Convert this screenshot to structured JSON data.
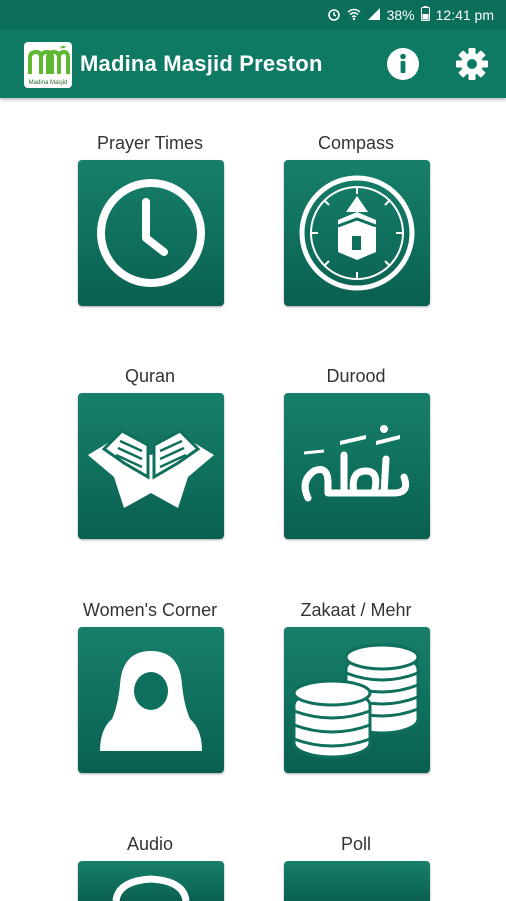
{
  "status_bar": {
    "battery_percent": "38%",
    "time": "12:41 pm",
    "icons": [
      "alarm-icon",
      "wifi-icon",
      "signal-icon",
      "battery-icon"
    ]
  },
  "app_bar": {
    "title": "Madina Masjid Preston",
    "logo_text": "Madina Masjid",
    "actions": [
      "info-icon",
      "settings-gear-icon"
    ]
  },
  "tiles": [
    {
      "label": "Prayer Times",
      "icon": "clock-icon"
    },
    {
      "label": "Compass",
      "icon": "kaaba-compass-icon"
    },
    {
      "label": "Quran",
      "icon": "open-quran-icon"
    },
    {
      "label": "Durood",
      "icon": "arabic-calligraphy-icon"
    },
    {
      "label": "Women's Corner",
      "icon": "hijab-woman-icon"
    },
    {
      "label": "Zakaat / Mehr",
      "icon": "coins-stack-icon"
    },
    {
      "label": "Audio",
      "icon": "audio-icon"
    },
    {
      "label": "Poll",
      "icon": "poll-icon"
    }
  ],
  "colors": {
    "primary": "#0f7a64",
    "status_bar": "#0b6e5b",
    "tile": "#0f6f5d",
    "logo_green": "#5fb832"
  }
}
